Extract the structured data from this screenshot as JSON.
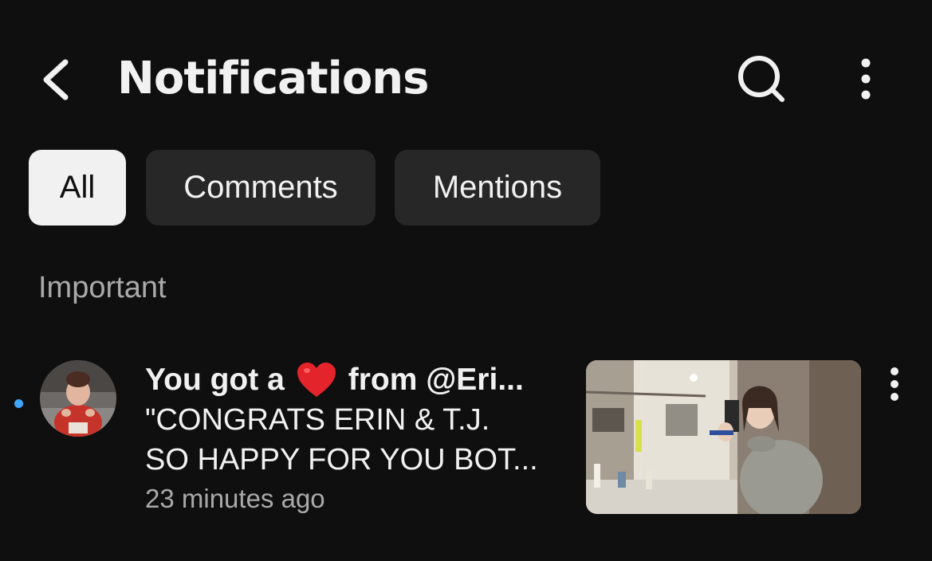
{
  "header": {
    "title": "Notifications",
    "back_icon": "chevron-left-icon",
    "search_icon": "search-icon",
    "more_icon": "more-vertical-icon"
  },
  "filters": [
    {
      "label": "All",
      "selected": true
    },
    {
      "label": "Comments",
      "selected": false
    },
    {
      "label": "Mentions",
      "selected": false
    }
  ],
  "section": {
    "heading": "Important"
  },
  "notifications": [
    {
      "title_prefix": "You got a",
      "title_suffix": "from @Eri...",
      "snippet_line1": "\"CONGRATS ERIN & T.J.",
      "snippet_line2": "SO HAPPY FOR YOU BOT...",
      "time": "23 minutes ago",
      "unread": true,
      "icon": "heart-icon"
    }
  ],
  "colors": {
    "background": "#0f0f0f",
    "chip": "#272727",
    "chip_selected": "#f1f1f1",
    "secondary_text": "#aaaaaa",
    "unread_dot": "#3ea6ff",
    "heart": "#e3242b"
  }
}
